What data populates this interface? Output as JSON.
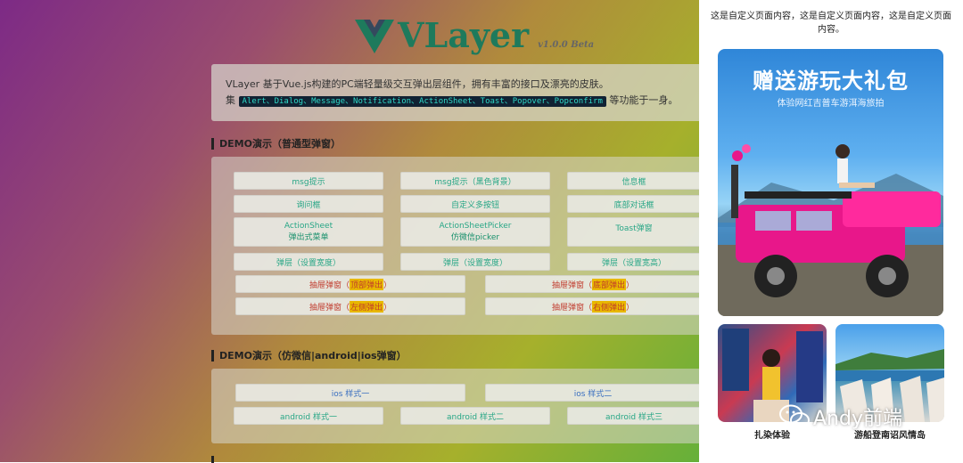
{
  "logo": {
    "name": "VLayer",
    "version": "v1.0.0 Beta"
  },
  "intro": {
    "line1": "VLayer 基于Vue.js构建的PC端轻量级交互弹出层组件，拥有丰富的接口及漂亮的皮肤。",
    "line2_prefix": "集",
    "line2_code": "Alert、Dialog、Message、Notification、ActionSheet、Toast、Popover、Popconfirm",
    "line2_suffix": "等功能于一身。"
  },
  "section1": {
    "title": "DEMO演示（普通型弹窗）",
    "buttons": {
      "msg": "msg提示",
      "msg_black": "msg提示（黑色背景）",
      "info": "信息框",
      "ask": "询问框",
      "custom_multi": "自定义多按钮",
      "bottom_dialog": "底部对话框",
      "actionsheet": "ActionSheet",
      "actionsheet_sub": "弹出式菜单",
      "actionsheet_picker": "ActionSheetPicker",
      "actionsheet_picker_sub": "仿微信picker",
      "toast": "Toast弹窗",
      "layer_width_1": "弹层（设置宽度）",
      "layer_width_2": "弹层（设置宽度）",
      "layer_width_3": "弹层（设置宽高）",
      "drawer_prefix": "抽屉弹窗（",
      "drawer_suffix": "）",
      "drawer_top": "顶部弹出",
      "drawer_bottom": "底部弹出",
      "drawer_left": "左侧弹出",
      "drawer_right": "右侧弹出"
    }
  },
  "section2": {
    "title": "DEMO演示（仿微信|android|ios弹窗）",
    "buttons": {
      "ios1": "ios 样式一",
      "ios2": "ios 样式二",
      "android1": "android 样式一",
      "android2": "android 样式二",
      "android3": "android 样式三"
    }
  },
  "sidebar": {
    "text": "这是自定义页面内容，这是自定义页面内容，这是自定义页面内容。",
    "banner_title": "赠送游玩大礼包",
    "banner_sub": "体验网红吉普车游洱海旅拍",
    "thumb1_label": "扎染体验",
    "thumb2_label": "游船登南诏风情岛"
  },
  "watermark": "Andy前端",
  "colors": {
    "accent": "#27a686",
    "red": "#c0392b",
    "blue": "#3a6fc0",
    "jeep": "#e8178a"
  }
}
